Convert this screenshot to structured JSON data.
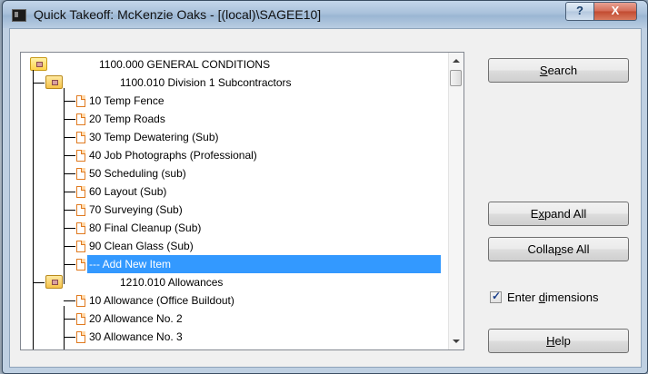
{
  "window": {
    "title": "Quick Takeoff:  McKenzie Oaks - [(local)\\SAGEE10]",
    "help_glyph": "?",
    "close_glyph": "X"
  },
  "tree": {
    "rows": [
      {
        "label": "1100.000  GENERAL CONDITIONS",
        "icon": "root-folder-icon"
      },
      {
        "label": "1100.010  Division 1 Subcontractors",
        "icon": "folder-icon"
      },
      {
        "label": "10  Temp Fence",
        "icon": "document-icon"
      },
      {
        "label": "20  Temp Roads",
        "icon": "document-icon"
      },
      {
        "label": "30  Temp Dewatering (Sub)",
        "icon": "document-icon"
      },
      {
        "label": "40  Job Photographs (Professional)",
        "icon": "document-icon"
      },
      {
        "label": "50  Scheduling (sub)",
        "icon": "document-icon"
      },
      {
        "label": "60  Layout (Sub)",
        "icon": "document-icon"
      },
      {
        "label": "70  Surveying (Sub)",
        "icon": "document-icon"
      },
      {
        "label": "80  Final Cleanup (Sub)",
        "icon": "document-icon"
      },
      {
        "label": "90  Clean Glass (Sub)",
        "icon": "document-icon"
      },
      {
        "label": "---  Add New Item",
        "icon": "document-icon",
        "selected": true
      },
      {
        "label": "1210.010  Allowances",
        "icon": "folder-icon"
      },
      {
        "label": "10  Allowance (Office Buildout)",
        "icon": "document-icon"
      },
      {
        "label": "20  Allowance No. 2",
        "icon": "document-icon"
      },
      {
        "label": "30  Allowance No. 3",
        "icon": "document-icon"
      }
    ]
  },
  "buttons": {
    "search": {
      "pre": "",
      "key": "S",
      "post": "earch"
    },
    "expand_all": {
      "pre": "E",
      "key": "x",
      "post": "pand All"
    },
    "collapse_all": {
      "pre": "Colla",
      "key": "p",
      "post": "se All"
    },
    "help": {
      "pre": "",
      "key": "H",
      "post": "elp"
    }
  },
  "enter_dimensions": {
    "checked": true,
    "pre": "Enter ",
    "key": "d",
    "post": "imensions"
  }
}
